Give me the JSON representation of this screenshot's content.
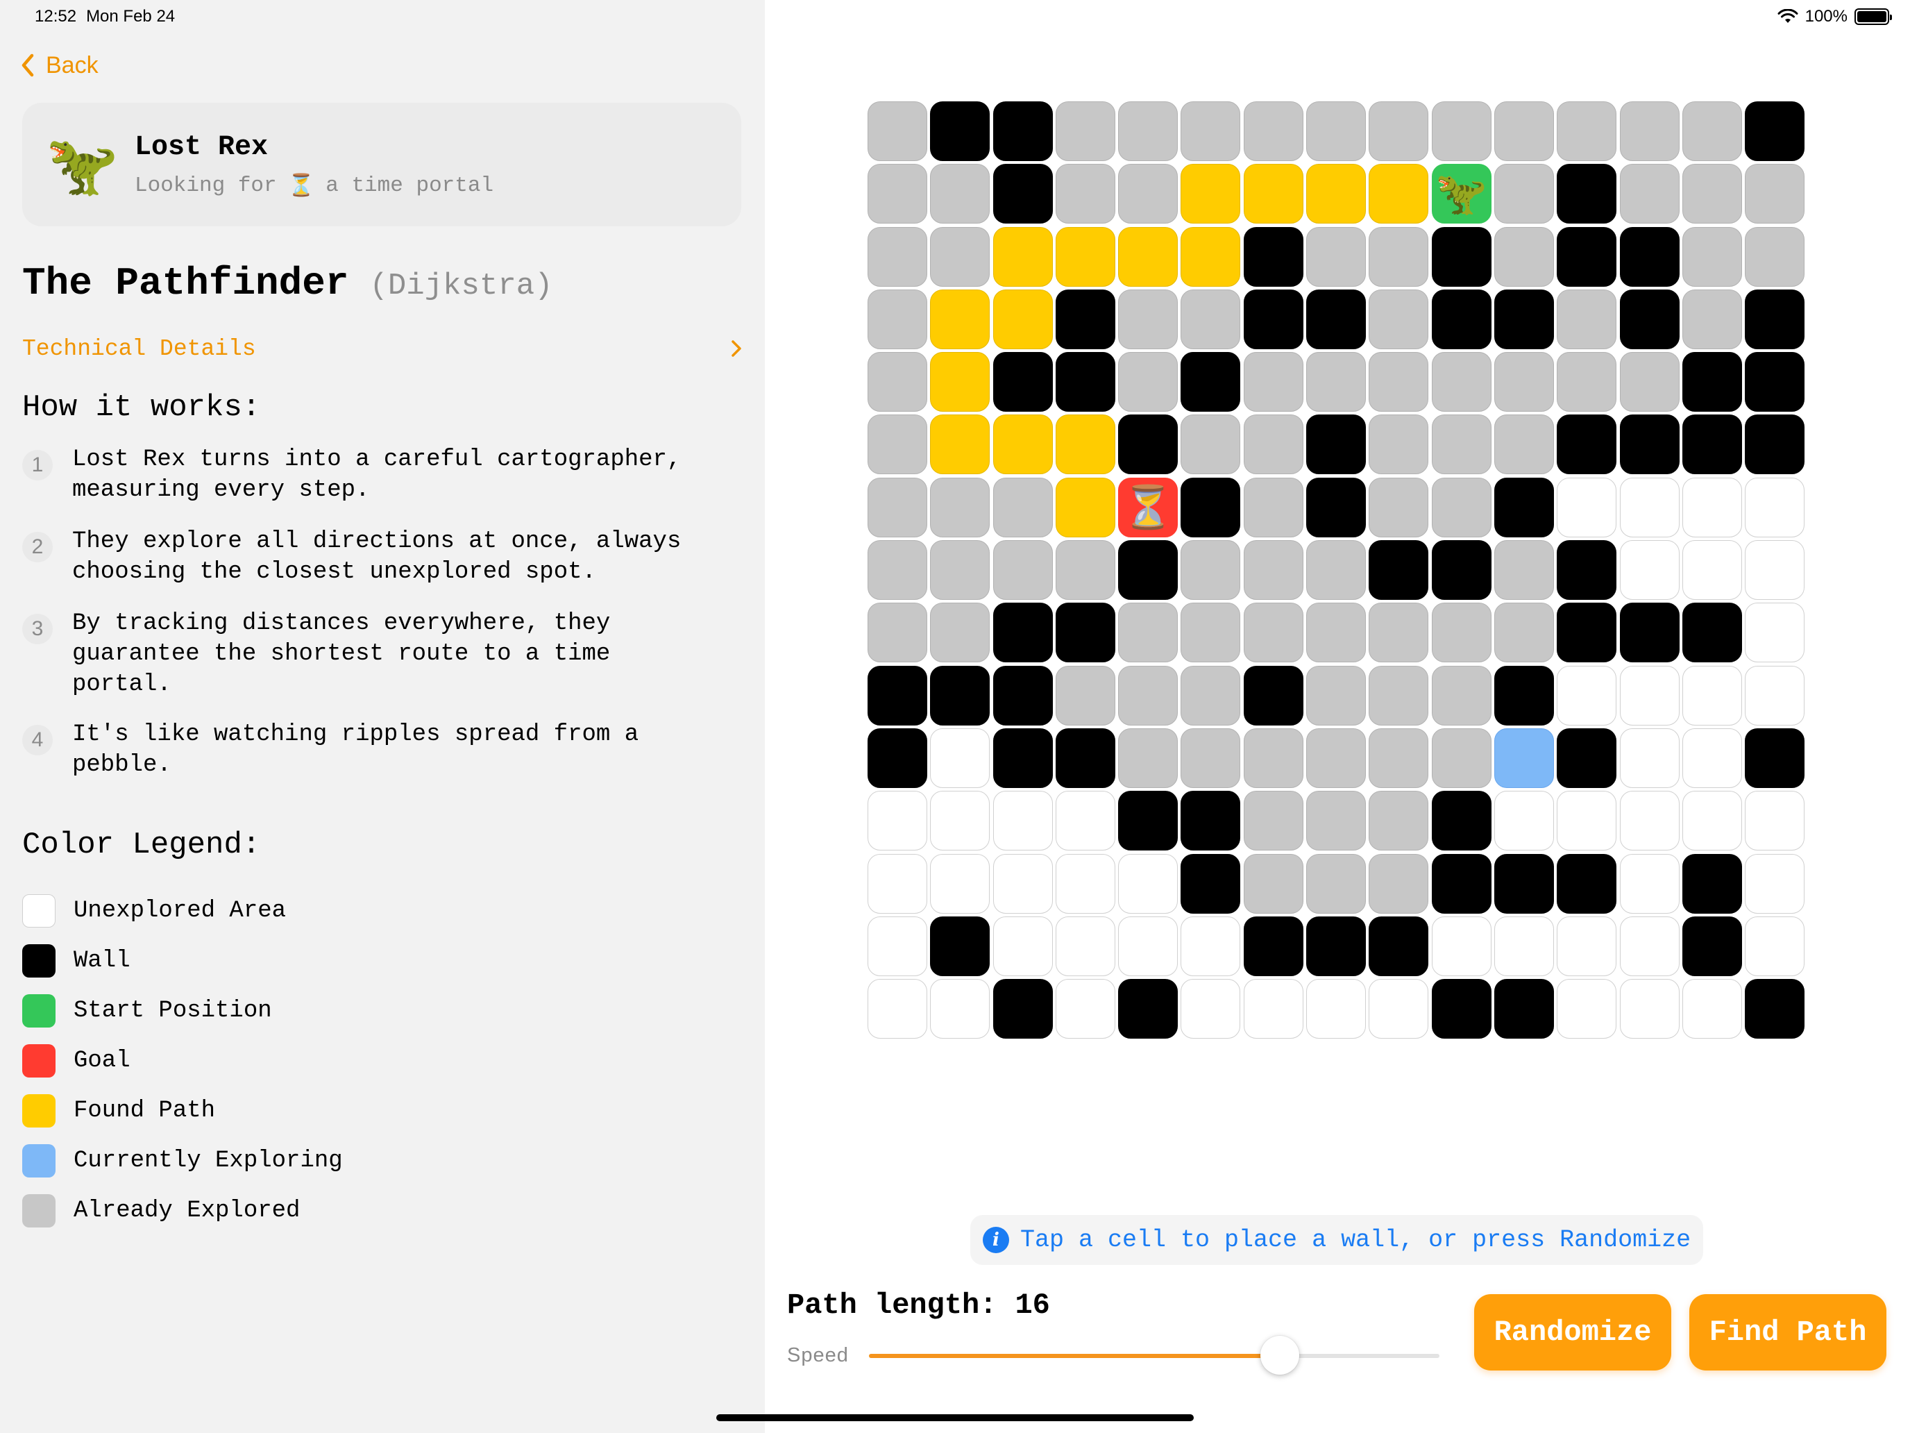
{
  "status_bar": {
    "time": "12:52",
    "date": "Mon Feb 24",
    "battery": "100%"
  },
  "back": {
    "label": "Back"
  },
  "profile": {
    "avatar": "🦖",
    "name": "Lost Rex",
    "subtitle_before": "Looking for",
    "subtitle_icon": "⏳",
    "subtitle_after": "a time portal"
  },
  "algorithm": {
    "title": "The Pathfinder",
    "subtitle": "(Dijkstra)",
    "details_link": "Technical Details"
  },
  "how_it_works": {
    "title": "How it works:",
    "steps": [
      {
        "num": "1",
        "text": "Lost Rex turns into a careful cartographer, measuring every step."
      },
      {
        "num": "2",
        "text": "They explore all directions at once, always choosing the closest unexplored spot."
      },
      {
        "num": "3",
        "text": "By tracking distances everywhere, they guarantee the shortest route to a time portal."
      },
      {
        "num": "4",
        "text": "It's like watching ripples spread from a pebble."
      }
    ]
  },
  "legend": {
    "title": "Color Legend:",
    "items": [
      {
        "label": "Unexplored Area",
        "color": "#ffffff"
      },
      {
        "label": "Wall",
        "color": "#000000"
      },
      {
        "label": "Start Position",
        "color": "#34c759"
      },
      {
        "label": "Goal",
        "color": "#ff3b30"
      },
      {
        "label": "Found Path",
        "color": "#ffcc00"
      },
      {
        "label": "Currently Exploring",
        "color": "#7eb8f7"
      },
      {
        "label": "Already Explored",
        "color": "#c7c7c7"
      }
    ]
  },
  "grid": {
    "cell_codes": "0=unexplored,1=wall,2=start,3=goal,4=path,5=exploring,6=explored",
    "start_icon": "🦖",
    "goal_icon": "⏳",
    "rows": [
      [
        6,
        1,
        1,
        6,
        6,
        6,
        6,
        6,
        6,
        6,
        6,
        6,
        6,
        6,
        1
      ],
      [
        6,
        6,
        1,
        6,
        6,
        4,
        4,
        4,
        4,
        2,
        6,
        1,
        6,
        6,
        6
      ],
      [
        6,
        6,
        4,
        4,
        4,
        4,
        1,
        6,
        6,
        1,
        6,
        1,
        1,
        6,
        6
      ],
      [
        6,
        4,
        4,
        1,
        6,
        6,
        1,
        1,
        6,
        1,
        1,
        6,
        1,
        6,
        1
      ],
      [
        6,
        4,
        1,
        1,
        6,
        1,
        6,
        6,
        6,
        6,
        6,
        6,
        6,
        1,
        1
      ],
      [
        6,
        4,
        4,
        4,
        1,
        6,
        6,
        1,
        6,
        6,
        6,
        1,
        1,
        1,
        1
      ],
      [
        6,
        6,
        6,
        4,
        3,
        1,
        6,
        1,
        6,
        6,
        1,
        0,
        0,
        0,
        0
      ],
      [
        6,
        6,
        6,
        6,
        1,
        6,
        6,
        6,
        1,
        1,
        6,
        1,
        0,
        0,
        0
      ],
      [
        6,
        6,
        1,
        1,
        6,
        6,
        6,
        6,
        6,
        6,
        6,
        1,
        1,
        1,
        0
      ],
      [
        1,
        1,
        1,
        6,
        6,
        6,
        1,
        6,
        6,
        6,
        1,
        0,
        0,
        0,
        0
      ],
      [
        1,
        0,
        1,
        1,
        6,
        6,
        6,
        6,
        6,
        6,
        5,
        1,
        0,
        0,
        1
      ],
      [
        0,
        0,
        0,
        0,
        1,
        1,
        6,
        6,
        6,
        1,
        0,
        0,
        0,
        0,
        0
      ],
      [
        0,
        0,
        0,
        0,
        0,
        1,
        6,
        6,
        6,
        1,
        1,
        1,
        0,
        1,
        0
      ],
      [
        0,
        1,
        0,
        0,
        0,
        0,
        1,
        1,
        1,
        0,
        0,
        0,
        0,
        1,
        0
      ],
      [
        0,
        0,
        1,
        0,
        1,
        0,
        0,
        0,
        0,
        1,
        1,
        0,
        0,
        0,
        1
      ]
    ]
  },
  "info": {
    "icon": "info-icon",
    "text": "Tap a cell to place a wall, or press Randomize"
  },
  "controls": {
    "path_length_label": "Path length:",
    "path_length_value": "16",
    "speed_label": "Speed",
    "speed_fraction": 0.72,
    "randomize_label": "Randomize",
    "find_path_label": "Find Path",
    "accent_color": "#ff9f0a"
  }
}
